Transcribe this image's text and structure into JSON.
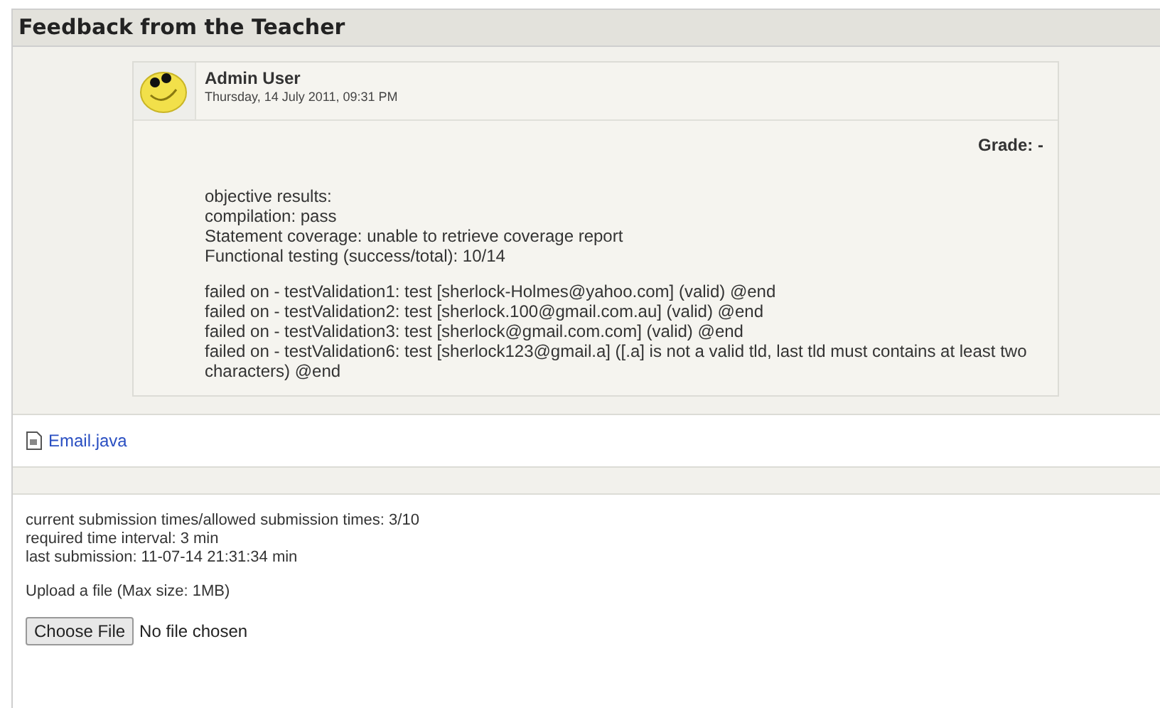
{
  "heading": "Feedback from the Teacher",
  "feedback": {
    "author": "Admin User",
    "date": "Thursday, 14 July 2011, 09:31 PM",
    "grade": "Grade: -",
    "paragraphs": [
      [
        "objective results:",
        "compilation: pass",
        "Statement coverage: unable to retrieve coverage report",
        "Functional testing (success/total): 10/14"
      ],
      [
        "failed on - testValidation1: test [sherlock-Holmes@yahoo.com] (valid) @end",
        "failed on - testValidation2: test [sherlock.100@gmail.com.au] (valid) @end",
        "failed on - testValidation3: test [sherlock@gmail.com.com] (valid) @end",
        "failed on - testValidation6: test [sherlock123@gmail.a] ([.a] is not a valid tld, last tld must contains at least two characters) @end"
      ]
    ]
  },
  "file": "Email.java",
  "submission": {
    "info": [
      "current submission times/allowed submission times: 3/10",
      "required time interval: 3 min",
      "last submission: 11-07-14 21:31:34 min"
    ],
    "upload_label": "Upload a file (Max size: 1MB)",
    "choose_button": "Choose File",
    "file_status": "No file chosen"
  }
}
